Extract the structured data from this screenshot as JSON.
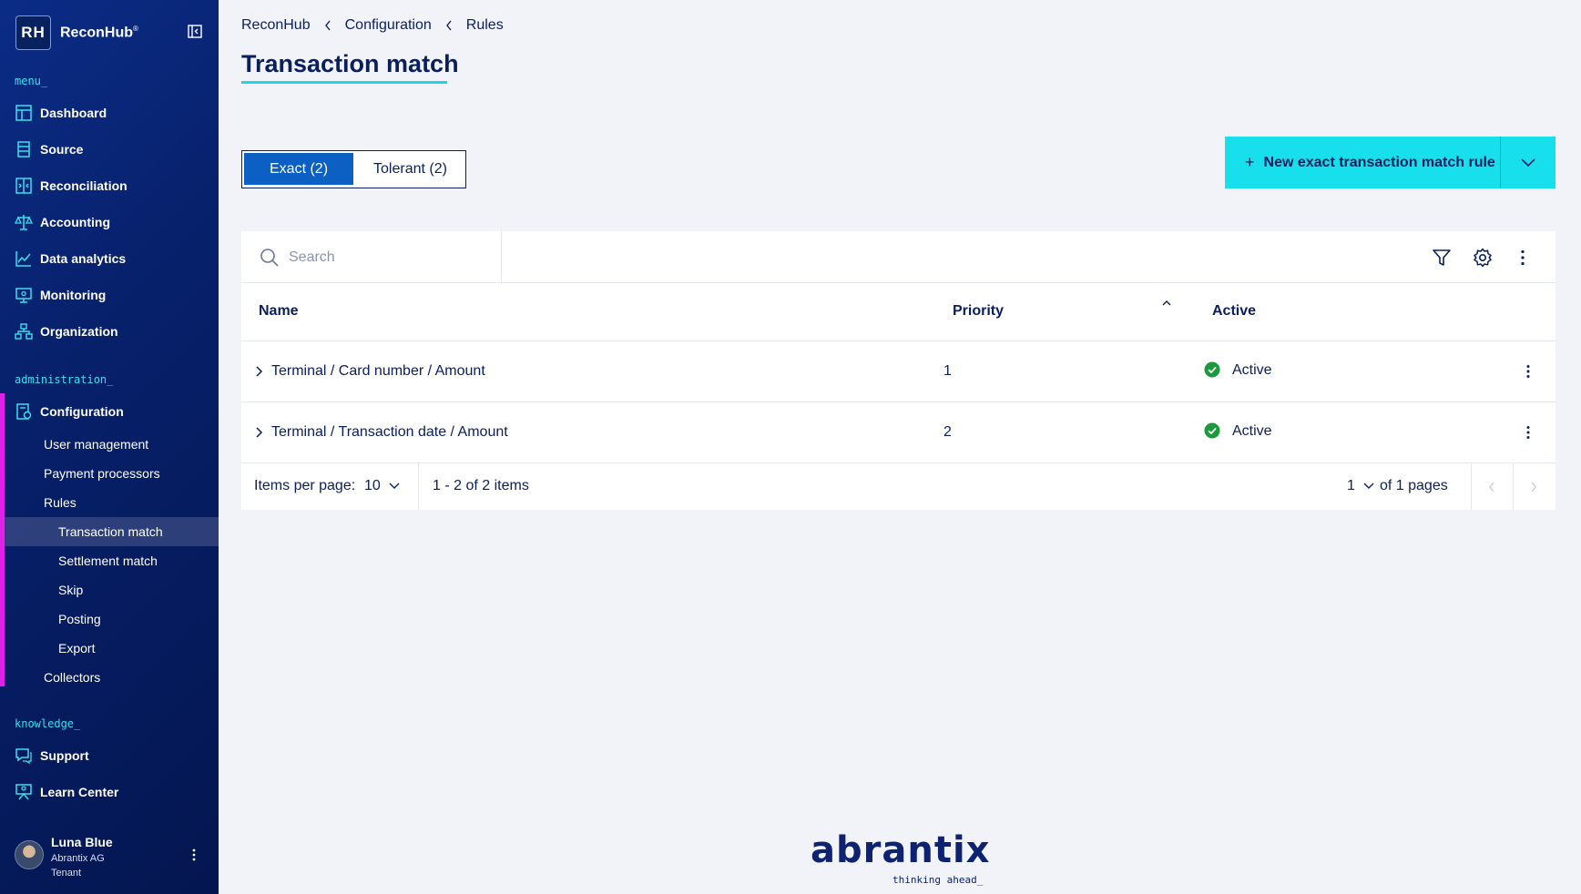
{
  "app": {
    "logo_initials": "RH",
    "name": "ReconHub",
    "trademark": "®"
  },
  "sidebar": {
    "menu_label": "menu_",
    "menu_items": [
      {
        "label": "Dashboard",
        "icon": "dashboard-icon"
      },
      {
        "label": "Source",
        "icon": "source-icon"
      },
      {
        "label": "Reconciliation",
        "icon": "reconciliation-icon"
      },
      {
        "label": "Accounting",
        "icon": "scale-icon"
      },
      {
        "label": "Data analytics",
        "icon": "chart-icon"
      },
      {
        "label": "Monitoring",
        "icon": "monitor-icon"
      },
      {
        "label": "Organization",
        "icon": "org-icon"
      }
    ],
    "admin_label": "administration_",
    "configuration": {
      "label": "Configuration",
      "children": [
        {
          "label": "User management"
        },
        {
          "label": "Payment processors"
        },
        {
          "label": "Rules"
        },
        {
          "label": "Transaction match"
        },
        {
          "label": "Settlement match"
        },
        {
          "label": "Skip"
        },
        {
          "label": "Posting"
        },
        {
          "label": "Export"
        },
        {
          "label": "Collectors"
        }
      ]
    },
    "knowledge_label": "knowledge_",
    "knowledge_items": [
      {
        "label": "Support",
        "icon": "support-icon"
      },
      {
        "label": "Learn Center",
        "icon": "learn-icon"
      }
    ],
    "user": {
      "name": "Luna Blue",
      "org": "Abrantix AG",
      "role": "Tenant"
    }
  },
  "breadcrumb": [
    "ReconHub",
    "Configuration",
    "Rules"
  ],
  "page_title": "Transaction match",
  "tabs": [
    {
      "label": "Exact (2)",
      "active": true
    },
    {
      "label": "Tolerant (2)",
      "active": false
    }
  ],
  "new_button": {
    "plus": "+",
    "label": "New exact transaction match rule"
  },
  "search": {
    "placeholder": "Search",
    "value": ""
  },
  "table": {
    "columns": [
      "Name",
      "Priority",
      "Active"
    ],
    "rows": [
      {
        "name": "Terminal / Card number / Amount",
        "priority": "1",
        "status": "Active"
      },
      {
        "name": "Terminal / Transaction date / Amount",
        "priority": "2",
        "status": "Active"
      }
    ]
  },
  "pagination": {
    "items_per_page_label": "Items per page:",
    "items_per_page": "10",
    "range": "1 - 2 of 2 items",
    "page": "1",
    "of_pages": "of 1 pages"
  },
  "footer": {
    "brand": "abrantix",
    "tagline": "thinking ahead_"
  },
  "colors": {
    "sidebar_bg": "#07206a",
    "accent_cyan": "#17e0ec",
    "accent_magenta": "#e020e8",
    "primary_blue": "#0c5fc3",
    "text_navy": "#0a1f5c",
    "success_green": "#1a9a3c"
  }
}
